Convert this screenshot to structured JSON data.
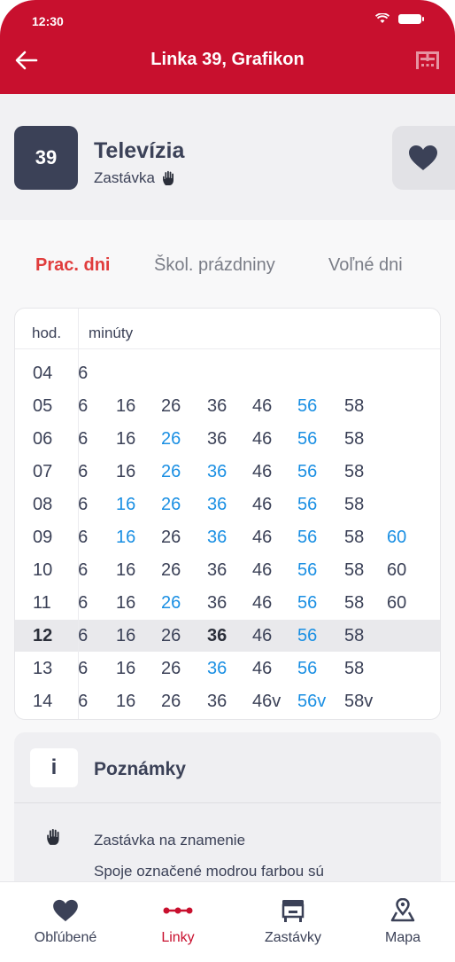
{
  "status_bar": {
    "time": "12:30"
  },
  "header": {
    "title": "Linka 39, Grafikon",
    "back_icon": "arrow-left-icon",
    "timetable_icon": "timetable-grid-icon"
  },
  "stop": {
    "line_number": "39",
    "name": "Televízia",
    "subtitle": "Zastávka",
    "subtitle_icon": "hand-icon",
    "favorite_icon": "heart-icon"
  },
  "tabs": [
    {
      "label": "Prac. dni",
      "active": true
    },
    {
      "label": "Škol. prázdniny",
      "active": false
    },
    {
      "label": "Voľné dni",
      "active": false
    }
  ],
  "timetable": {
    "col_hour": "hod.",
    "col_minutes": "minúty",
    "rows": [
      {
        "hour": "04",
        "current": false,
        "minutes": [
          {
            "t": "06"
          }
        ]
      },
      {
        "hour": "05",
        "current": false,
        "minutes": [
          {
            "t": "06"
          },
          {
            "t": "16"
          },
          {
            "t": "26"
          },
          {
            "t": "36"
          },
          {
            "t": "46"
          },
          {
            "t": "56",
            "blue": true
          },
          {
            "t": "58"
          }
        ]
      },
      {
        "hour": "06",
        "current": false,
        "minutes": [
          {
            "t": "06"
          },
          {
            "t": "16"
          },
          {
            "t": "26",
            "blue": true
          },
          {
            "t": "36"
          },
          {
            "t": "46"
          },
          {
            "t": "56",
            "blue": true
          },
          {
            "t": "58"
          }
        ]
      },
      {
        "hour": "07",
        "current": false,
        "minutes": [
          {
            "t": "06"
          },
          {
            "t": "16"
          },
          {
            "t": "26",
            "blue": true
          },
          {
            "t": "36",
            "blue": true
          },
          {
            "t": "46"
          },
          {
            "t": "56",
            "blue": true
          },
          {
            "t": "58"
          }
        ]
      },
      {
        "hour": "08",
        "current": false,
        "minutes": [
          {
            "t": "06"
          },
          {
            "t": "16",
            "blue": true
          },
          {
            "t": "26",
            "blue": true
          },
          {
            "t": "36",
            "blue": true
          },
          {
            "t": "46"
          },
          {
            "t": "56",
            "blue": true
          },
          {
            "t": "58"
          }
        ]
      },
      {
        "hour": "09",
        "current": false,
        "minutes": [
          {
            "t": "06"
          },
          {
            "t": "16",
            "blue": true
          },
          {
            "t": "26"
          },
          {
            "t": "36",
            "blue": true
          },
          {
            "t": "46"
          },
          {
            "t": "56",
            "blue": true
          },
          {
            "t": "58"
          },
          {
            "t": "60",
            "blue": true
          }
        ]
      },
      {
        "hour": "10",
        "current": false,
        "minutes": [
          {
            "t": "06"
          },
          {
            "t": "16"
          },
          {
            "t": "26"
          },
          {
            "t": "36"
          },
          {
            "t": "46"
          },
          {
            "t": "56",
            "blue": true
          },
          {
            "t": "58"
          },
          {
            "t": "60"
          }
        ]
      },
      {
        "hour": "11",
        "current": false,
        "minutes": [
          {
            "t": "06"
          },
          {
            "t": "16"
          },
          {
            "t": "26",
            "blue": true
          },
          {
            "t": "36"
          },
          {
            "t": "46"
          },
          {
            "t": "56",
            "blue": true
          },
          {
            "t": "58"
          },
          {
            "t": "60"
          }
        ]
      },
      {
        "hour": "12",
        "current": true,
        "minutes": [
          {
            "t": "06"
          },
          {
            "t": "16"
          },
          {
            "t": "26"
          },
          {
            "t": "36",
            "bold": true
          },
          {
            "t": "46"
          },
          {
            "t": "56",
            "blue": true
          },
          {
            "t": "58"
          }
        ]
      },
      {
        "hour": "13",
        "current": false,
        "minutes": [
          {
            "t": "06"
          },
          {
            "t": "16"
          },
          {
            "t": "26"
          },
          {
            "t": "36",
            "blue": true
          },
          {
            "t": "46"
          },
          {
            "t": "56",
            "blue": true
          },
          {
            "t": "58"
          }
        ]
      },
      {
        "hour": "14",
        "current": false,
        "minutes": [
          {
            "t": "06"
          },
          {
            "t": "16"
          },
          {
            "t": "26"
          },
          {
            "t": "36"
          },
          {
            "t": "46v"
          },
          {
            "t": "56v",
            "blue": true
          },
          {
            "t": "58v"
          }
        ]
      }
    ]
  },
  "notes": {
    "icon": "info-icon",
    "title": "Poznámky",
    "items": [
      {
        "icon": "hand-icon",
        "text": "Zastávka na znamenie"
      },
      {
        "text": "Spoje označené modrou farbou sú"
      }
    ]
  },
  "bottom_nav": [
    {
      "label": "Obľúbené",
      "icon": "heart-icon",
      "active": false
    },
    {
      "label": "Linky",
      "icon": "line-route-icon",
      "active": true
    },
    {
      "label": "Zastávky",
      "icon": "bus-stop-icon",
      "active": false
    },
    {
      "label": "Mapa",
      "icon": "map-pin-icon",
      "active": false
    }
  ],
  "colors": {
    "brand_red": "#c8102e",
    "active_tab": "#e03c3c",
    "blue_departure": "#1a8fe3",
    "dark": "#3b4157"
  }
}
